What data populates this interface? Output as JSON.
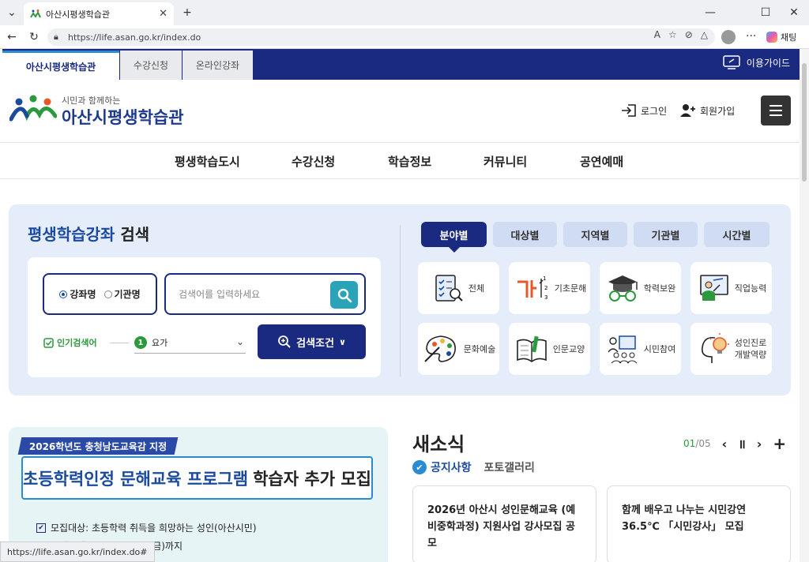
{
  "browser": {
    "tab_title": "아산시평생학습관",
    "url": "https://life.asan.go.kr/index.do",
    "copilot_label": "채팅",
    "status_url": "https://life.asan.go.kr/index.do#"
  },
  "topnav": {
    "tabs": [
      "아산시평생학습관",
      "수강신청",
      "온라인강좌"
    ],
    "guide_label": "이용가이드"
  },
  "header": {
    "logo_sub": "시민과 함께하는",
    "logo_main": "아산시평생학습관",
    "login_label": "로그인",
    "signup_label": "회원가입"
  },
  "gnb": [
    "평생학습도시",
    "수강신청",
    "학습정보",
    "커뮤니티",
    "공연예매"
  ],
  "search": {
    "title_blue": "평생학습강좌",
    "title_black": "검색",
    "radio_course": "강좌명",
    "radio_org": "기관명",
    "placeholder": "검색어를 입력하세요",
    "popular_label": "인기검색어",
    "keyword_num": "1",
    "keyword": "요가",
    "condition_label": "검색조건"
  },
  "filter_tabs": [
    "분야별",
    "대상별",
    "지역별",
    "기관별",
    "시간별"
  ],
  "categories": [
    {
      "label": "전체",
      "icon": "checklist-icon"
    },
    {
      "label": "기초문해",
      "icon": "korean-letters-icon"
    },
    {
      "label": "학력보완",
      "icon": "graduation-cap-icon"
    },
    {
      "label": "직업능력",
      "icon": "teacher-board-icon"
    },
    {
      "label": "문화예술",
      "icon": "palette-icon"
    },
    {
      "label": "인문교양",
      "icon": "open-book-icon"
    },
    {
      "label": "시민참여",
      "icon": "audience-icon"
    },
    {
      "label": "성인진로\n개발역량",
      "icon": "lightbulb-head-icon"
    }
  ],
  "banner": {
    "pill": "2026학년도 충청남도교육감 지정",
    "title_blue": "초등학력인정 문해교육 프로그램",
    "title_black": "학습자 추가 모집",
    "line1": "모집대상: 초등학력 취득을 희망하는 성인(아산시민)",
    "line2": "모집기간: 2026. 5. 29.(금)까지"
  },
  "news": {
    "title": "새소식",
    "tab_notice": "공지사항",
    "tab_photo": "포토갤러리",
    "page_current": "01",
    "page_total": "/05",
    "cards": [
      "2026년 아산시 성인문해교육 (예비중학과정) 지원사업 강사모집 공모",
      "함께 배우고 나누는 시민강연 36.5℃ 「시민강사」 모집"
    ]
  },
  "colors": {
    "navy": "#1a2a80",
    "blue": "#1a4a9e",
    "green": "#2c9a3c",
    "teal": "#2aa3b8"
  }
}
